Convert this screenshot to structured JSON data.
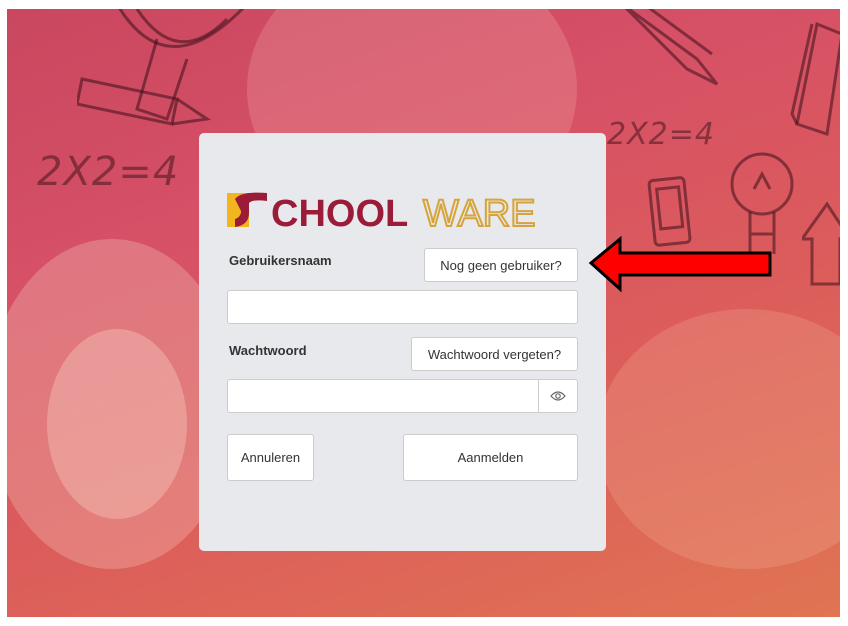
{
  "logo": {
    "text": "SCHOOLWARE",
    "accent_color": "#f2b51e",
    "brand_color": "#9b1c38",
    "light_color": "#d6a43a"
  },
  "form": {
    "username_label": "Gebruikersnaam",
    "register_button": "Nog geen gebruiker?",
    "username_value": "",
    "password_label": "Wachtwoord",
    "forgot_button": "Wachtwoord vergeten?",
    "password_value": "",
    "show_password_icon": "eye-icon",
    "cancel_button": "Annuleren",
    "login_button": "Aanmelden"
  },
  "background": {
    "doodle_left": "2X2=4",
    "doodle_right": "2X2=4"
  },
  "annotation": {
    "arrow_color": "#ff0000",
    "arrow_icon": "left-arrow"
  }
}
